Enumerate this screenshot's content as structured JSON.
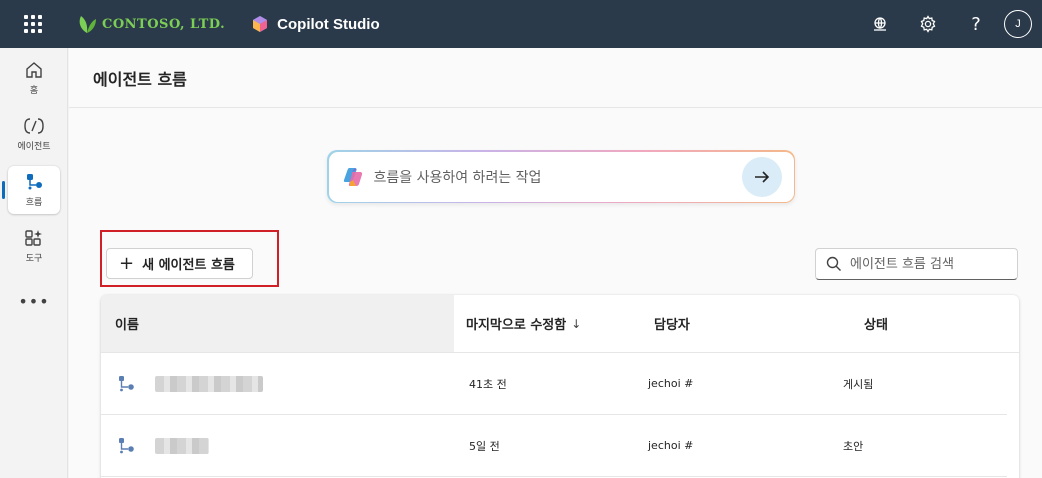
{
  "topbar": {
    "brand_name": "CONTOSO, LTD.",
    "product_name": "Copilot Studio",
    "help_glyph": "?",
    "avatar_initial": "J",
    "icons": [
      "waffle-icon",
      "app-launcher-icon",
      "settings-icon",
      "help-icon"
    ]
  },
  "rail": {
    "items": [
      {
        "label": "홈",
        "icon": "home-icon"
      },
      {
        "label": "에이전트",
        "icon": "agent-icon"
      },
      {
        "label": "흐름",
        "icon": "flow-icon",
        "active": true
      },
      {
        "label": "도구",
        "icon": "tools-icon"
      }
    ],
    "more_glyph": "•••"
  },
  "page": {
    "title": "에이전트 흐름"
  },
  "prompt": {
    "placeholder": "흐름을 사용하여 하려는 작업"
  },
  "toolbar": {
    "new_flow_label": "새 에이전트 흐름",
    "plus_glyph": "+"
  },
  "search": {
    "placeholder": "에이전트 흐름 검색"
  },
  "table": {
    "columns": {
      "name": "이름",
      "modified": "마지막으로 수정함",
      "owner": "담당자",
      "status": "상태"
    },
    "sort_glyph": "↓",
    "rows": [
      {
        "modified": "41초 전",
        "owner": "jechoi #",
        "status": "게시됨"
      },
      {
        "modified": "5일 전",
        "owner": "jechoi #",
        "status": "초안"
      }
    ]
  },
  "colors": {
    "topbar": "#2b3a4a",
    "brand": "#7ccf55",
    "accent": "#0f6cbd",
    "highlight": "#d11f27"
  }
}
